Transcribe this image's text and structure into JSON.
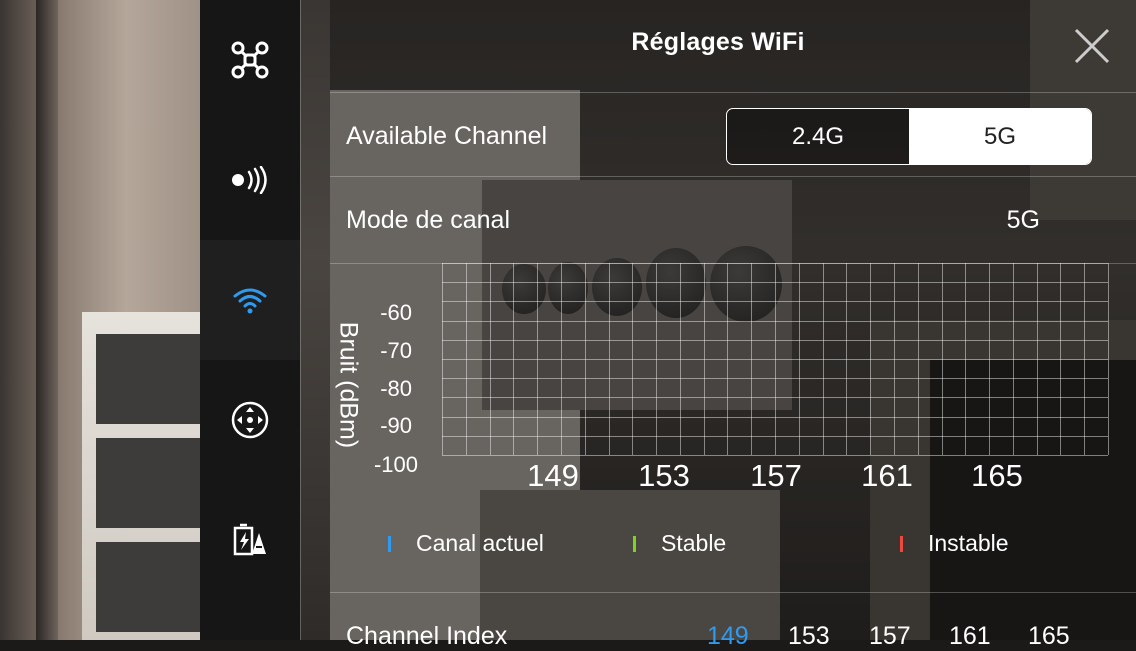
{
  "header": {
    "title": "Réglages WiFi"
  },
  "sidebar": {
    "items": [
      {
        "icon": "drone-icon",
        "active": false
      },
      {
        "icon": "signal-icon",
        "active": false
      },
      {
        "icon": "wifi-icon",
        "active": true
      },
      {
        "icon": "gimbal-icon",
        "active": false
      },
      {
        "icon": "battery-icon",
        "active": false
      }
    ]
  },
  "available_channel": {
    "label": "Available Channel",
    "options": [
      "2.4G",
      "5G"
    ],
    "selected": "5G"
  },
  "channel_mode": {
    "label": "Mode de canal",
    "value": "5G"
  },
  "chart_data": {
    "type": "bar",
    "ylabel": "Bruit (dBm)",
    "yticks": [
      "-60",
      "-70",
      "-80",
      "-90",
      "-100"
    ],
    "ylim": [
      -100,
      -60
    ],
    "xticks": [
      "149",
      "153",
      "157",
      "161",
      "165"
    ],
    "grid": true,
    "series": [],
    "legend": [
      {
        "label": "Canal actuel",
        "color": "#2e9bf0"
      },
      {
        "label": "Stable",
        "color": "#7ed321"
      },
      {
        "label": "Instable",
        "color": "#f0483e"
      }
    ]
  },
  "channel_index": {
    "label": "Channel Index",
    "values": [
      "149",
      "153",
      "157",
      "161",
      "165"
    ],
    "current": "149"
  },
  "colors": {
    "accent": "#2e9bf0",
    "sidebar": "#161616"
  }
}
